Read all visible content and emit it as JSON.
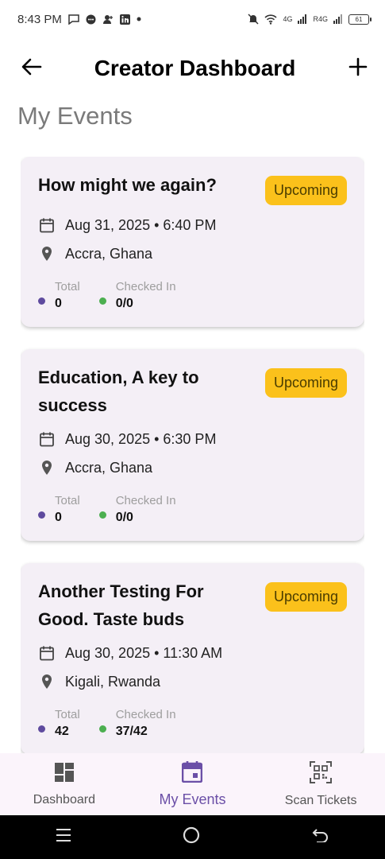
{
  "status_bar": {
    "time": "8:43 PM",
    "network_1": "4G",
    "network_2": "R4G",
    "battery": "61"
  },
  "app_bar": {
    "title": "Creator Dashboard",
    "back_icon": "arrow-left-icon",
    "add_icon": "plus-icon"
  },
  "section_title": "My Events",
  "events": [
    {
      "title": "How might we again?",
      "status": "Upcoming",
      "datetime": "Aug 31, 2025 • 6:40 PM",
      "location": "Accra, Ghana",
      "total_label": "Total",
      "total_value": "0",
      "checked_label": "Checked In",
      "checked_value": "0/0"
    },
    {
      "title": "Education, A key to success",
      "status": "Upcoming",
      "datetime": "Aug 30, 2025 • 6:30 PM",
      "location": "Accra, Ghana",
      "total_label": "Total",
      "total_value": "0",
      "checked_label": "Checked In",
      "checked_value": "0/0"
    },
    {
      "title": "Another Testing For Good. Taste buds",
      "status": "Upcoming",
      "datetime": "Aug 30, 2025 • 11:30 AM",
      "location": "Kigali, Rwanda",
      "total_label": "Total",
      "total_value": "42",
      "checked_label": "Checked In",
      "checked_value": "37/42"
    }
  ],
  "bottom_nav": {
    "items": [
      {
        "label": "Dashboard",
        "icon": "dashboard-icon"
      },
      {
        "label": "My Events",
        "icon": "calendar-icon"
      },
      {
        "label": "Scan Tickets",
        "icon": "qr-code-icon"
      }
    ]
  },
  "colors": {
    "accent": "#6b4fa7",
    "badge": "#fbc11b",
    "card_bg": "#f4eff6",
    "total_dot": "#5e4a9e",
    "checked_dot": "#4caf50"
  }
}
